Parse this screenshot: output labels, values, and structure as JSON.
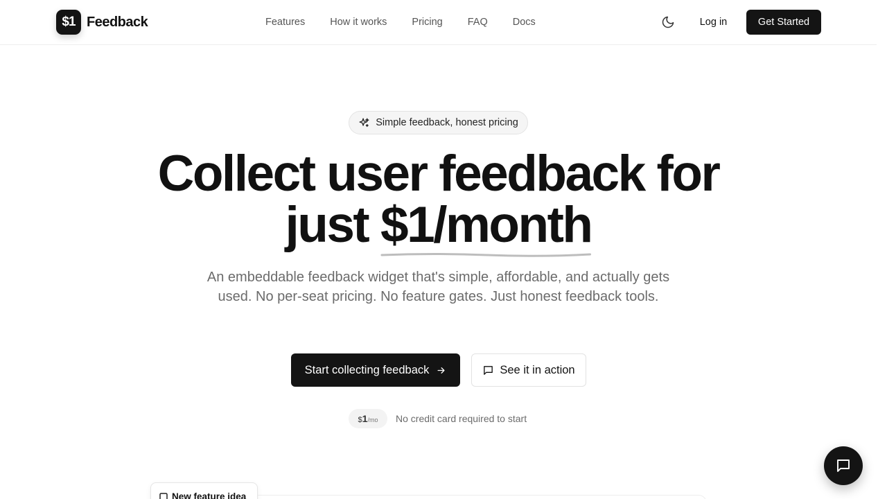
{
  "brand": {
    "logo_mark": "$1",
    "name": "Feedback"
  },
  "nav": {
    "items": [
      {
        "label": "Features"
      },
      {
        "label": "How it works"
      },
      {
        "label": "Pricing"
      },
      {
        "label": "FAQ"
      },
      {
        "label": "Docs"
      }
    ]
  },
  "header": {
    "theme_icon": "moon-icon",
    "login_label": "Log in",
    "get_started_label": "Get Started"
  },
  "hero": {
    "pill_icon": "sparkles-icon",
    "pill_text": "Simple feedback, honest pricing",
    "title_line1": "Collect user feedback for",
    "title_line2_prefix": "just",
    "title_price": "$1/month",
    "subtitle": "An embeddable feedback widget that's simple, affordable, and actually gets used. No per-seat pricing. No feature gates. Just honest feedback tools.",
    "cta_primary_label": "Start collecting feedback",
    "cta_primary_icon": "arrow-right-icon",
    "cta_secondary_label": "See it in action",
    "cta_secondary_icon": "message-square-icon",
    "price_badge": {
      "currency": "$",
      "amount": "1",
      "period": "/mo"
    },
    "no_card_text": "No credit card required to start"
  },
  "preview": {
    "feature_card_label": "New feature idea"
  },
  "chat_widget": {
    "icon": "chat-bubble-icon"
  },
  "colors": {
    "primary": "#141414",
    "text": "#111111",
    "muted": "#6b6b6b",
    "border": "#e3e3e3",
    "background": "#ffffff"
  }
}
